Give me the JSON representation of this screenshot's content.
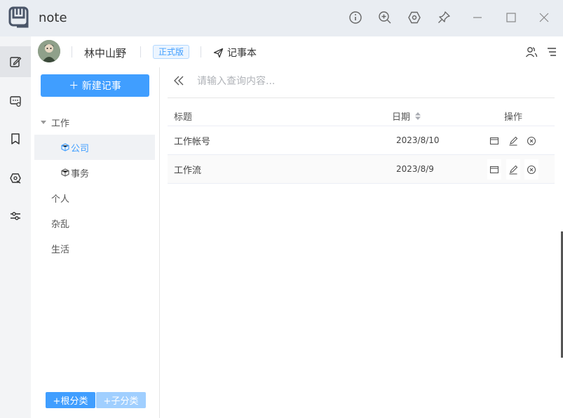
{
  "app": {
    "title": "note"
  },
  "user": {
    "name": "林中山野",
    "edition": "正式版",
    "notebook_link": "记事本"
  },
  "sidebar": {
    "new_note_label": "＋ 新建记事",
    "tree": [
      {
        "label": "工作",
        "expanded": true
      },
      {
        "label": "公司",
        "selected": true
      },
      {
        "label": "事务"
      },
      {
        "label": "个人"
      },
      {
        "label": "杂乱"
      },
      {
        "label": "生活"
      }
    ],
    "add_root_label": "+根分类",
    "add_child_label": "+子分类"
  },
  "search": {
    "placeholder": "请输入查询内容..."
  },
  "table": {
    "columns": {
      "title": "标题",
      "date": "日期",
      "ops": "操作"
    },
    "rows": [
      {
        "title": "工作帐号",
        "date": "2023/8/10"
      },
      {
        "title": "工作流",
        "date": "2023/8/9"
      }
    ]
  },
  "colors": {
    "accent": "#409eff",
    "accent_disabled": "#a0cfff",
    "titlebar_bg": "#e9edf2",
    "rail_bg": "#f3f4f6"
  },
  "icons": {
    "titlebar": [
      "info-icon",
      "zoom-in-icon",
      "settings-hex-icon",
      "pin-icon",
      "minimize-icon",
      "maximize-icon",
      "close-icon"
    ],
    "rail": [
      "edit-note-icon",
      "chat-icon",
      "bookmark-icon",
      "tools-icon",
      "sliders-icon"
    ],
    "row_ops": [
      "view-icon",
      "edit-icon",
      "delete-icon"
    ]
  }
}
